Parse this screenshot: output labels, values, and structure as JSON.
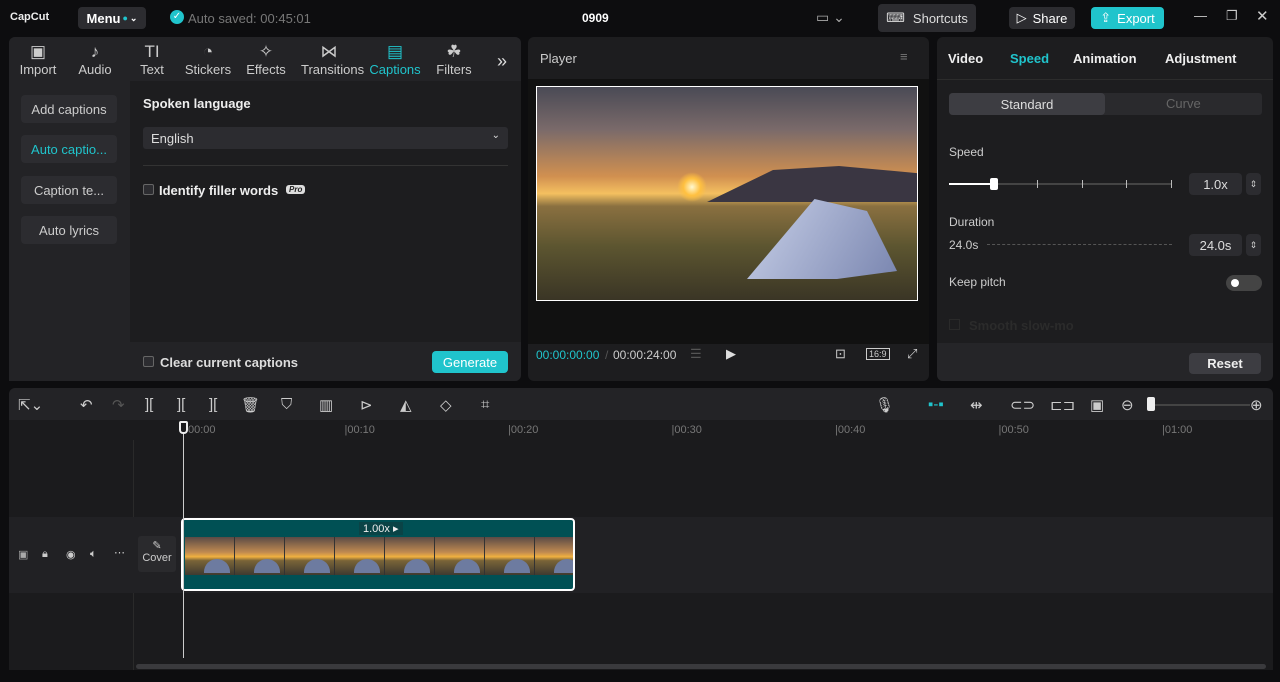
{
  "app": {
    "logo": "CapCut",
    "menu": "Menu",
    "autosave": "Auto saved: 00:45:01",
    "project": "0909",
    "shortcuts": "Shortcuts",
    "share": "Share",
    "export": "Export"
  },
  "media_tabs": [
    {
      "label": "Import",
      "icon": "import-icon"
    },
    {
      "label": "Audio",
      "icon": "audio-icon"
    },
    {
      "label": "Text",
      "icon": "text-icon"
    },
    {
      "label": "Stickers",
      "icon": "stickers-icon"
    },
    {
      "label": "Effects",
      "icon": "effects-icon"
    },
    {
      "label": "Transitions",
      "icon": "transitions-icon"
    },
    {
      "label": "Captions",
      "icon": "captions-icon"
    },
    {
      "label": "Filters",
      "icon": "filters-icon"
    }
  ],
  "captions": {
    "side": [
      "Add captions",
      "Auto captio...",
      "Caption te...",
      "Auto lyrics"
    ],
    "spoken_language_label": "Spoken language",
    "language": "English",
    "filler": "Identify filler words",
    "pro": "Pro",
    "clear": "Clear current captions",
    "generate": "Generate"
  },
  "player": {
    "title": "Player",
    "current": "00:00:00:00",
    "total": "00:00:24:00",
    "ratio": "16:9"
  },
  "inspector": {
    "tabs": [
      "Video",
      "Speed",
      "Animation",
      "Adjustment"
    ],
    "modes": [
      "Standard",
      "Curve"
    ],
    "speed_label": "Speed",
    "speed_value": "1.0x",
    "speed_fraction": 0.2,
    "duration_label": "Duration",
    "duration_start": "24.0s",
    "duration_value": "24.0s",
    "keep_pitch": "Keep pitch",
    "keep_pitch_on": false,
    "smooth": "Smooth slow-mo",
    "reset": "Reset"
  },
  "timeline": {
    "ticks": [
      "00:00",
      "|00:10",
      "|00:20",
      "|00:30",
      "|00:40",
      "|00:50",
      "|01:00"
    ],
    "clip_speed": "1.00x",
    "cover": "Cover"
  },
  "colors": {
    "accent": "#20c4cc",
    "clip": "#005054"
  }
}
